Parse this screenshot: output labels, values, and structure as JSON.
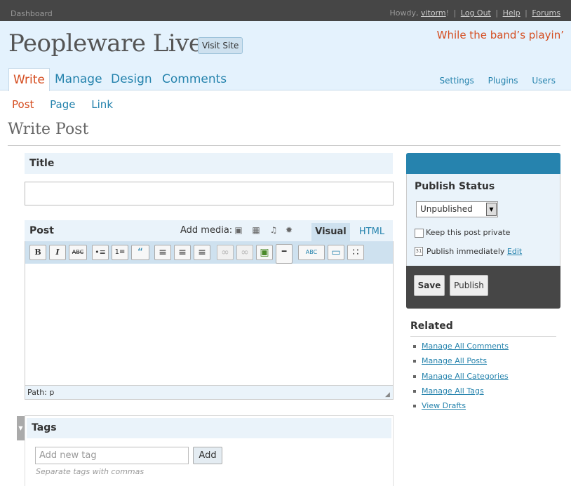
{
  "topbar": {
    "dashboard": "Dashboard",
    "howdy": "Howdy,",
    "username": "vitorm",
    "excl": "!",
    "logout": "Log Out",
    "help": "Help",
    "forums": "Forums"
  },
  "header": {
    "blog_title": "Peopleware Live",
    "visit_site": "Visit Site",
    "tagline": "While the band’s playin’"
  },
  "mainnav": [
    "Write",
    "Manage",
    "Design",
    "Comments"
  ],
  "sidenav": [
    "Settings",
    "Plugins",
    "Users"
  ],
  "subnav": [
    "Post",
    "Page",
    "Link"
  ],
  "page_title": "Write Post",
  "title_box": {
    "label": "Title",
    "value": ""
  },
  "post_box": {
    "label": "Post",
    "add_media": "Add media:",
    "tab_visual": "Visual",
    "tab_html": "HTML",
    "toolbar": {
      "bold": "B",
      "italic": "I",
      "strike": "ABC",
      "bullist": "•≡",
      "numlist": "1≡",
      "quote": "“",
      "alignleft": "≡",
      "aligncenter": "≡",
      "alignright": "≡",
      "link": "∞",
      "unlink": "∞",
      "image": "▣",
      "more": "━",
      "spell": "ABC",
      "fullscreen": "▭",
      "kitchensink": "∷"
    },
    "path": "Path: p"
  },
  "tags_box": {
    "label": "Tags",
    "placeholder": "Add new tag",
    "add": "Add",
    "hint": "Separate tags with commas"
  },
  "publish": {
    "status_label": "Publish Status",
    "status_value": "Unpublished",
    "private_label": "Keep this post private",
    "publish_immediately": "Publish immediately",
    "edit": "Edit",
    "save": "Save",
    "publish": "Publish"
  },
  "related": {
    "label": "Related",
    "items": [
      "Manage All Comments",
      "Manage All Posts",
      "Manage All Categories",
      "Manage All Tags",
      "View Drafts"
    ]
  },
  "colors": {
    "accent": "#d54e21",
    "link": "#2583ad",
    "header_bg": "#e4f2fd",
    "topbar_bg": "#464646",
    "publish_bar": "#2683ae"
  },
  "icons": {
    "media_image": "image-icon",
    "media_gallery": "gallery-icon",
    "media_audio": "music-icon",
    "media_other": "sun-icon",
    "calendar": "calendar-icon",
    "tags_toggle": "triangle-down-icon"
  }
}
